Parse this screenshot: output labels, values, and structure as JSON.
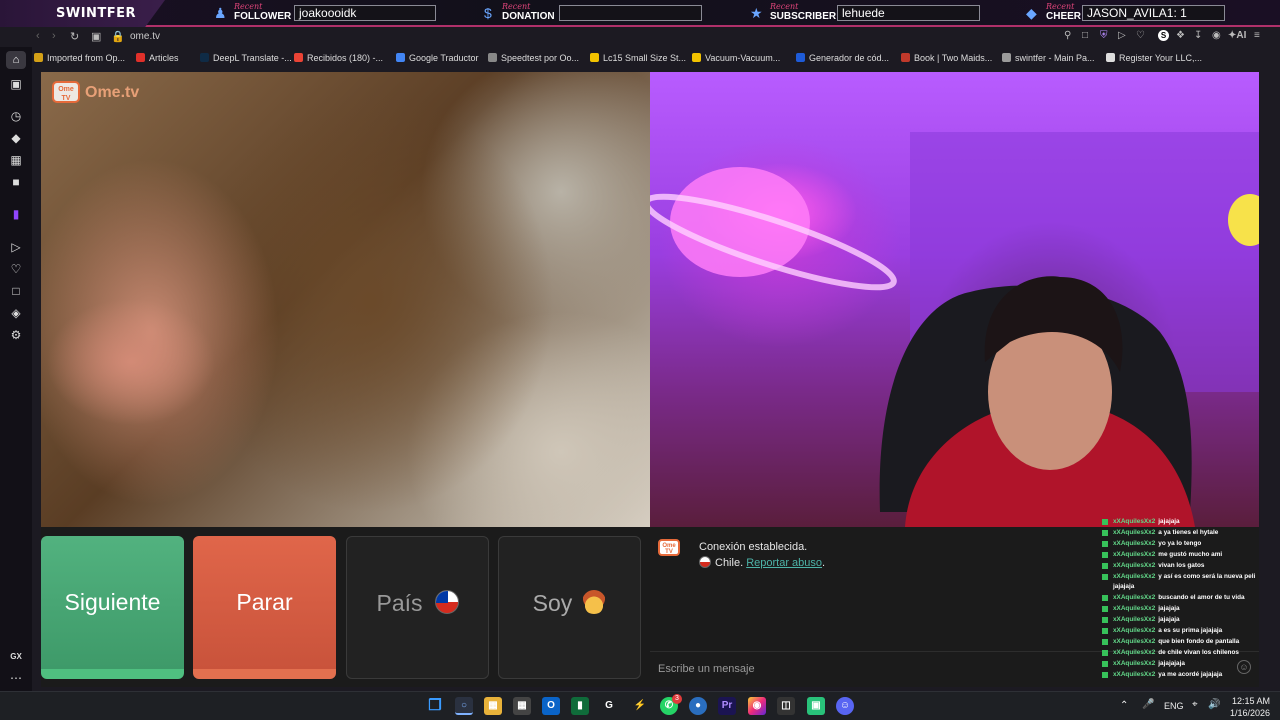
{
  "overlay": {
    "brand": "SWINTFER",
    "recent_label": "Recent",
    "follower": {
      "label": "FOLLOWER",
      "value": "joakoooidk",
      "icon": "user-icon"
    },
    "donation": {
      "label": "DONATION",
      "value": "",
      "icon": "dollar-icon"
    },
    "subscriber": {
      "label": "SUBSCRIBER",
      "value": "lehuede",
      "icon": "star-icon"
    },
    "cheer": {
      "label": "CHEER",
      "value": "JASON_AVILA1: 1",
      "icon": "gem-icon"
    }
  },
  "browser": {
    "url": "ome.tv",
    "bookmarks": [
      {
        "label": "Imported from Op...",
        "color": "#d4a017"
      },
      {
        "label": "Articles",
        "color": "#e0302a"
      },
      {
        "label": "DeepL Translate -...",
        "color": "#0f2b46"
      },
      {
        "label": "Recibidos (180) -...",
        "color": "#ea4335"
      },
      {
        "label": "Google Traductor",
        "color": "#4285f4"
      },
      {
        "label": "Speedtest por Oo...",
        "color": "#888888"
      },
      {
        "label": "Lc15 Small Size St...",
        "color": "#f2c200"
      },
      {
        "label": "Vacuum-Vacuum...",
        "color": "#f2c200"
      },
      {
        "label": "Generador de cód...",
        "color": "#1e5bd8"
      },
      {
        "label": "Book | Two Maids...",
        "color": "#c0392b"
      },
      {
        "label": "swintfer - Main Pa...",
        "color": "#9b9b9b"
      },
      {
        "label": "Register Your LLC,...",
        "color": "#dddddd"
      }
    ],
    "toolbar_ai": "AI",
    "gx_label": "GX"
  },
  "page": {
    "logo_text": "Ome.tv",
    "logo_box": "Ome TV",
    "buttons": {
      "next": "Siguiente",
      "stop": "Parar",
      "country": "País",
      "gender": "Soy"
    },
    "chat": {
      "status": "Conexión establecida.",
      "country": "Chile.",
      "report": "Reportar abuso",
      "report_suffix": ".",
      "placeholder": "Escribe un mensaje"
    }
  },
  "twitch_chat": [
    {
      "user": "xXAquilesXx2",
      "text": "jajajaja"
    },
    {
      "user": "xXAquilesXx2",
      "text": "a ya tienes el hytale"
    },
    {
      "user": "xXAquilesXx2",
      "text": "yo ya lo tengo"
    },
    {
      "user": "xXAquilesXx2",
      "text": "me gustó mucho ami"
    },
    {
      "user": "xXAquilesXx2",
      "text": "vivan los gatos"
    },
    {
      "user": "xXAquilesXx2",
      "text": "y así es como será la nueva peli"
    },
    {
      "user": "",
      "text": "jajajaja"
    },
    {
      "user": "xXAquilesXx2",
      "text": "buscando el amor de tu vida"
    },
    {
      "user": "xXAquilesXx2",
      "text": "jajajaja"
    },
    {
      "user": "xXAquilesXx2",
      "text": "jajajaja"
    },
    {
      "user": "xXAquilesXx2",
      "text": "a es su prima jajajaja"
    },
    {
      "user": "xXAquilesXx2",
      "text": "que bien fondo de pantalla"
    },
    {
      "user": "xXAquilesXx2",
      "text": "de chile vivan los chilenos"
    },
    {
      "user": "xXAquilesXx2",
      "text": "jajajajaja"
    },
    {
      "user": "xXAquilesXx2",
      "text": "ya me acordé jajajaja"
    }
  ],
  "taskbar": {
    "lang": "ENG",
    "time": "12:15 AM",
    "date": "1/16/2026",
    "whatsapp_badge": "3"
  }
}
